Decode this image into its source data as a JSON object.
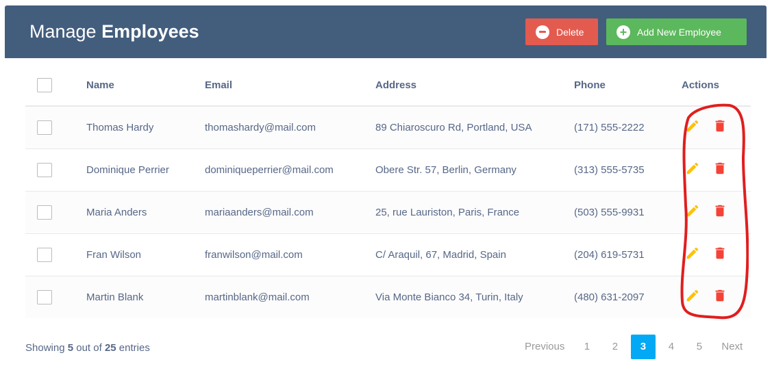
{
  "header": {
    "title_light": "Manage",
    "title_bold": "Employees",
    "delete_label": "Delete",
    "add_label": "Add New Employee"
  },
  "table": {
    "columns": [
      "Name",
      "Email",
      "Address",
      "Phone",
      "Actions"
    ],
    "rows": [
      {
        "name": "Thomas Hardy",
        "email": "thomashardy@mail.com",
        "address": "89 Chiaroscuro Rd, Portland, USA",
        "phone": "(171) 555-2222"
      },
      {
        "name": "Dominique Perrier",
        "email": "dominiqueperrier@mail.com",
        "address": "Obere Str. 57, Berlin, Germany",
        "phone": "(313) 555-5735"
      },
      {
        "name": "Maria Anders",
        "email": "mariaanders@mail.com",
        "address": "25, rue Lauriston, Paris, France",
        "phone": "(503) 555-9931"
      },
      {
        "name": "Fran Wilson",
        "email": "franwilson@mail.com",
        "address": "C/ Araquil, 67, Madrid, Spain",
        "phone": "(204) 619-5731"
      },
      {
        "name": "Martin Blank",
        "email": "martinblank@mail.com",
        "address": "Via Monte Bianco 34, Turin, Italy",
        "phone": "(480) 631-2097"
      }
    ],
    "icons": {
      "edit": "pencil-icon",
      "delete": "trash-icon"
    }
  },
  "footer": {
    "showing_prefix": "Showing",
    "showing_count": "5",
    "showing_mid": "out of",
    "showing_total": "25",
    "showing_suffix": "entries"
  },
  "pagination": {
    "previous": "Previous",
    "pages": [
      "1",
      "2",
      "3",
      "4",
      "5"
    ],
    "current": "3",
    "next": "Next"
  },
  "colors": {
    "header_bg": "#435d7d",
    "delete_btn": "#e35b4f",
    "add_btn": "#5cb85c",
    "edit_icon": "#ffc107",
    "delete_icon": "#f44336",
    "active_page": "#03a9f4",
    "annotation": "#e01e1e"
  }
}
